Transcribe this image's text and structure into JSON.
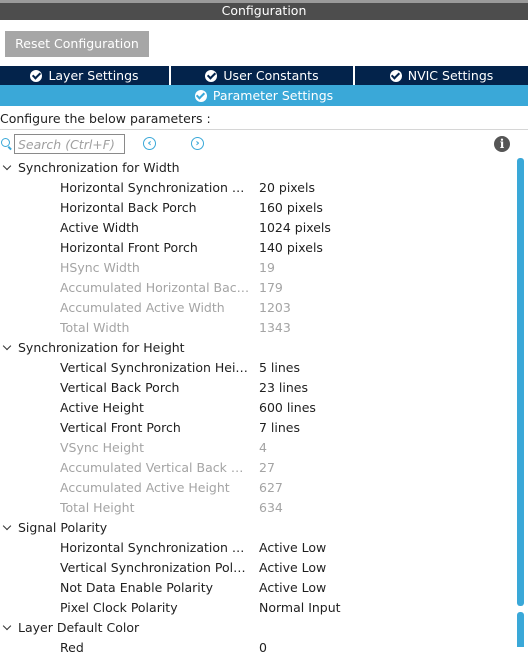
{
  "window": {
    "title": "Configuration"
  },
  "toolbar": {
    "reset_label": "Reset Configuration"
  },
  "tabs": [
    {
      "label": "Layer Settings"
    },
    {
      "label": "User Constants"
    },
    {
      "label": "NVIC Settings"
    }
  ],
  "active_tab": {
    "label": "Parameter Settings"
  },
  "hint": "Configure the below parameters :",
  "search": {
    "placeholder": "Search (Ctrl+F)",
    "value": ""
  },
  "nav": {
    "prev": "‹",
    "next": "›"
  },
  "info": {
    "glyph": "i"
  },
  "groups": [
    {
      "label": "Synchronization for Width",
      "params": [
        {
          "name": "Horizontal Synchronization Width",
          "value": "20 pixels",
          "disabled": false
        },
        {
          "name": "Horizontal Back Porch",
          "value": "160 pixels",
          "disabled": false
        },
        {
          "name": "Active Width",
          "value": "1024 pixels",
          "disabled": false
        },
        {
          "name": "Horizontal Front Porch",
          "value": "140 pixels",
          "disabled": false
        },
        {
          "name": "HSync Width",
          "value": "19",
          "disabled": true
        },
        {
          "name": "Accumulated Horizontal Back ...",
          "value": "179",
          "disabled": true
        },
        {
          "name": "Accumulated Active Width",
          "value": "1203",
          "disabled": true
        },
        {
          "name": "Total Width",
          "value": "1343",
          "disabled": true
        }
      ]
    },
    {
      "label": "Synchronization for Height",
      "params": [
        {
          "name": "Vertical Synchronization Height",
          "value": "5 lines",
          "disabled": false
        },
        {
          "name": "Vertical Back Porch",
          "value": "23 lines",
          "disabled": false
        },
        {
          "name": "Active Height",
          "value": "600 lines",
          "disabled": false
        },
        {
          "name": "Vertical Front Porch",
          "value": "7 lines",
          "disabled": false
        },
        {
          "name": "VSync Height",
          "value": "4",
          "disabled": true
        },
        {
          "name": "Accumulated Vertical Back Por...",
          "value": "27",
          "disabled": true
        },
        {
          "name": "Accumulated Active Height",
          "value": "627",
          "disabled": true
        },
        {
          "name": "Total Height",
          "value": "634",
          "disabled": true
        }
      ]
    },
    {
      "label": "Signal Polarity",
      "params": [
        {
          "name": "Horizontal Synchronization Pol...",
          "value": "Active Low",
          "disabled": false
        },
        {
          "name": "Vertical Synchronization Polarity",
          "value": "Active Low",
          "disabled": false
        },
        {
          "name": "Not Data Enable Polarity",
          "value": "Active Low",
          "disabled": false
        },
        {
          "name": "Pixel Clock Polarity",
          "value": "Normal Input",
          "disabled": false
        }
      ]
    },
    {
      "label": "Layer Default Color",
      "params": [
        {
          "name": "Red",
          "value": "0",
          "disabled": false
        }
      ]
    }
  ],
  "colors": {
    "title_bar": "#4d4d4d",
    "tab_dark": "#03234b",
    "accent": "#3aa8d8",
    "disabled_text": "#a4a4a4"
  }
}
